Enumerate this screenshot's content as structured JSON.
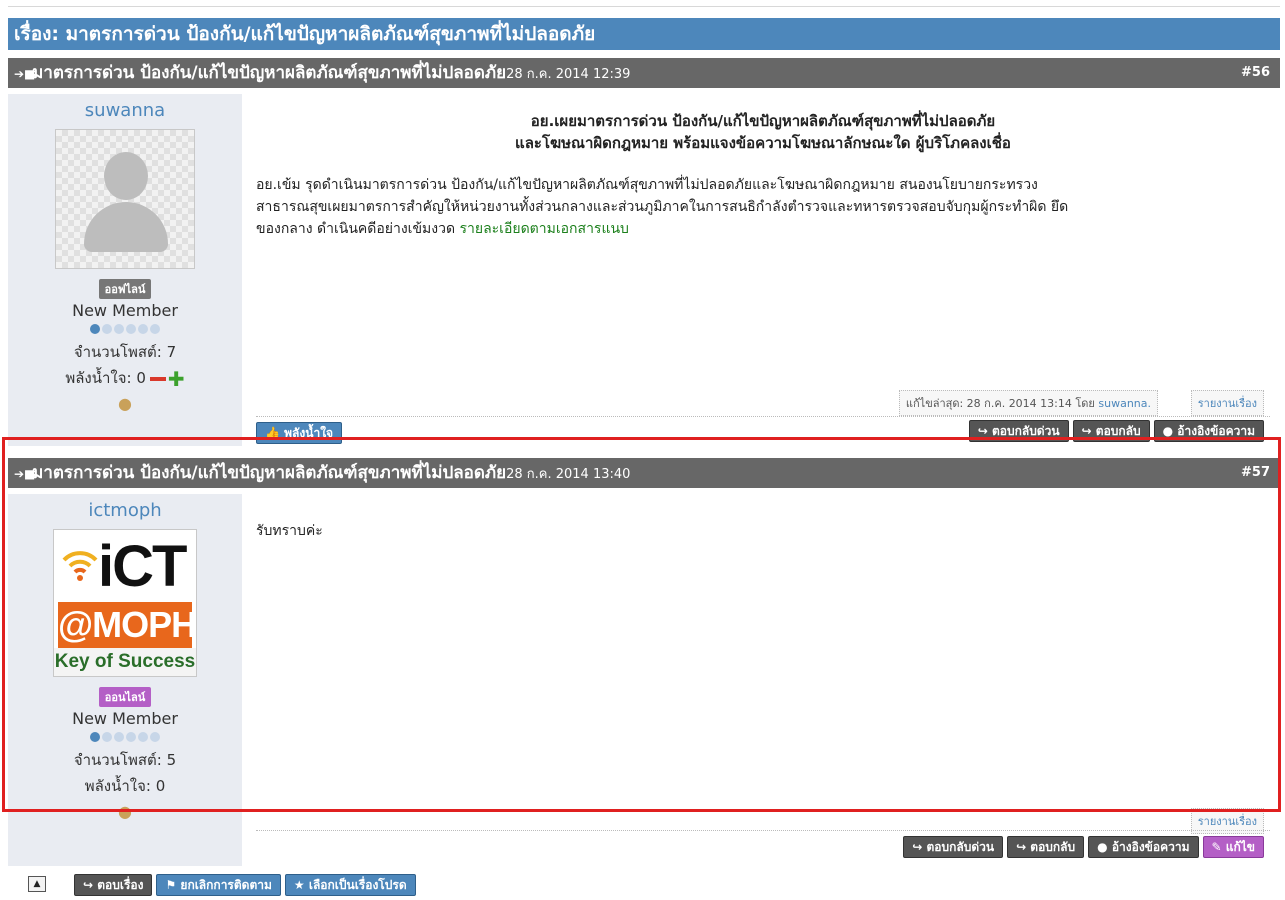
{
  "topic": {
    "title": "เรื่อง: มาตรการด่วน ป้องกัน/แก้ไขปัญหาผลิตภัณฑ์สุขภาพที่ไม่ปลอดภัย"
  },
  "posts": [
    {
      "title": "มาตรการด่วน ป้องกัน/แก้ไขปัญหาผลิตภัณฑ์สุขภาพที่ไม่ปลอดภัย",
      "date": "28 ก.ค. 2014 12:39",
      "number": "#56",
      "username": "suwanna",
      "status": "ออฟไลน์",
      "rank": "New Member",
      "post_count": "จำนวนโพสต์: 7",
      "karma": "พลังน้ำใจ: 0",
      "headline1": "อย.เผยมาตรการด่วน ป้องกัน/แก้ไขปัญหาผลิตภัณฑ์สุขภาพที่ไม่ปลอดภัย",
      "headline2": "และโฆษณาผิดกฎหมาย พร้อมแจงข้อความโฆษณาลักษณะใด ผู้บริโภคลงเชื่อ",
      "body1": "อย.เข้ม รุดดำเนินมาตรการด่วน ป้องกัน/แก้ไขปัญหาผลิตภัณฑ์สุขภาพที่ไม่ปลอดภัยและโฆษณาผิดกฎหมาย สนองนโยบายกระทรวง",
      "body2": "สาธารณสุขเผยมาตรการสำคัญให้หน่วยงานทั้งส่วนกลางและส่วนภูมิภาคในการสนธิกำลังตำรวจและทหารตรวจสอบจับกุมผู้กระทำผิด ยึด",
      "body3": "ของกลาง ดำเนินคดีอย่างเข้มงวด ",
      "body_link": "รายละเอียดตามเอกสารแนบ",
      "edit_prefix": "แก้ไขล่าสุด: 28 ก.ค. 2014 13:14 โดย ",
      "edit_by": "suwanna.",
      "report": "รายงานเรื่อง",
      "karma_btn": "พลังน้ำใจ",
      "quick_reply": "ตอบกลับด่วน",
      "reply": "ตอบกลับ",
      "quote": "อ้างอิงข้อความ"
    },
    {
      "title": "มาตรการด่วน ป้องกัน/แก้ไขปัญหาผลิตภัณฑ์สุขภาพที่ไม่ปลอดภัย",
      "date": "28 ก.ค. 2014 13:40",
      "number": "#57",
      "username": "ictmoph",
      "avatar_text": {
        "ict": "iCT",
        "moph": "@MOPH",
        "slogan": "Key of Success"
      },
      "status": "ออนไลน์",
      "rank": "New Member",
      "post_count": "จำนวนโพสต์: 5",
      "karma": "พลังน้ำใจ: 0",
      "body": "รับทราบค่ะ",
      "report": "รายงานเรื่อง",
      "quick_reply": "ตอบกลับด่วน",
      "reply": "ตอบกลับ",
      "quote": "อ้างอิงข้อความ",
      "edit": "แก้ไข"
    }
  ],
  "bottom": {
    "reply_topic": "ตอบเรื่อง",
    "unfollow": "ยกเลิกการติดตาม",
    "favorite": "เลือกเป็นเรื่องโปรด"
  },
  "colors": {
    "topic_bar": "#4d87bb",
    "post_header": "#676767",
    "highlight": "#e02020"
  }
}
